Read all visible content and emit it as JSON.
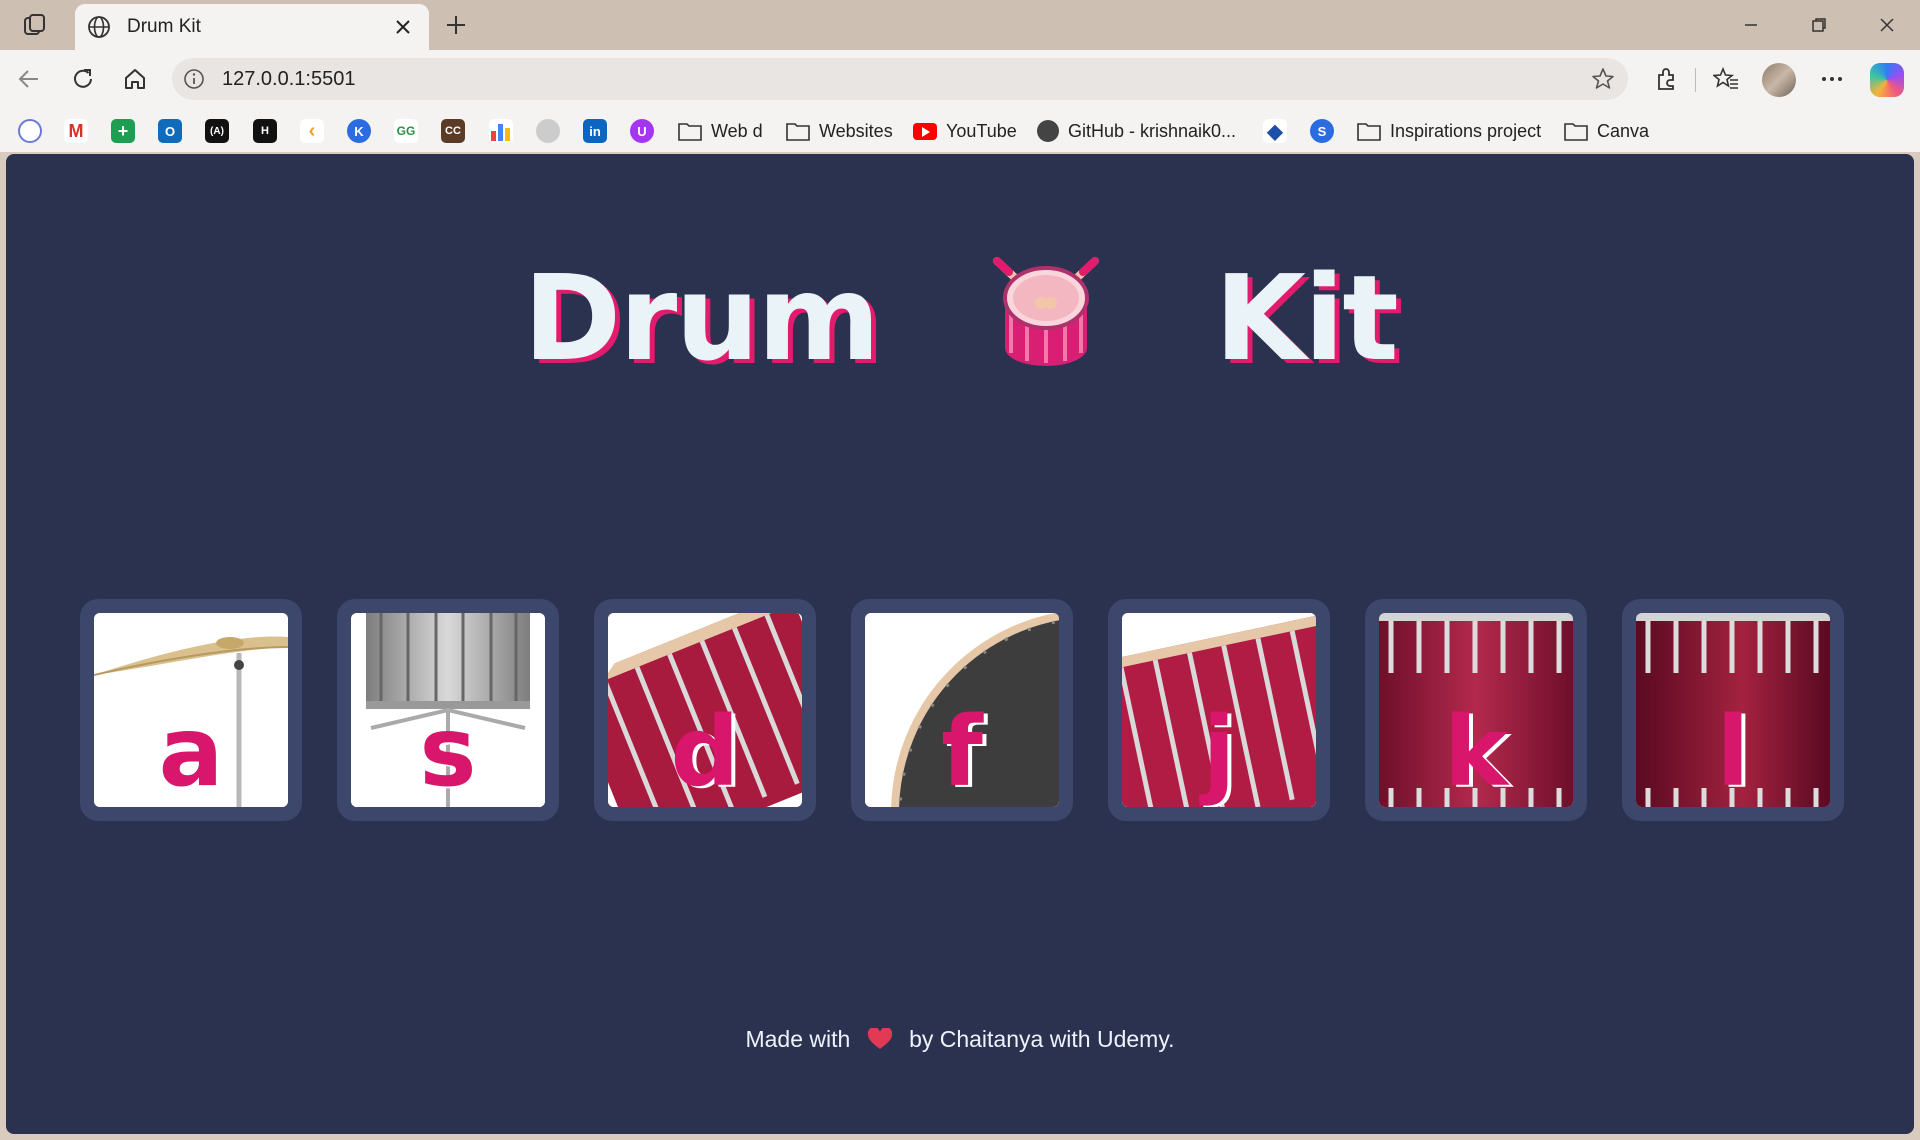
{
  "browser": {
    "tab_title": "Drum Kit",
    "url": "127.0.0.1:5501",
    "bookmarks": [
      {
        "type": "folder",
        "label": "Web d"
      },
      {
        "type": "folder",
        "label": "Websites"
      },
      {
        "type": "youtube",
        "label": "YouTube"
      },
      {
        "type": "github",
        "label": "GitHub - krishnaik0..."
      },
      {
        "type": "folder",
        "label": "Inspirations project"
      },
      {
        "type": "folder",
        "label": "Canva"
      }
    ],
    "bookmark_icons": [
      "chrome-icon",
      "gmail-icon",
      "sheets-icon",
      "outlook-icon",
      "devto-icon",
      "hackerrank-icon",
      "leetcode-icon",
      "krishna-icon",
      "gfg-icon",
      "codechef-icon",
      "chart-icon",
      "github-icon",
      "linkedin-icon",
      "udemy-icon"
    ]
  },
  "page": {
    "title_left": "Drum",
    "title_right": "Kit",
    "drums": [
      {
        "key": "a",
        "image": "crash-cymbal"
      },
      {
        "key": "s",
        "image": "snare-drum"
      },
      {
        "key": "d",
        "image": "tom-1"
      },
      {
        "key": "f",
        "image": "bass-drum"
      },
      {
        "key": "j",
        "image": "tom-2"
      },
      {
        "key": "k",
        "image": "tom-3"
      },
      {
        "key": "l",
        "image": "tom-4"
      }
    ],
    "footer": {
      "before": "Made with",
      "after": "by Chaitanya with Udemy."
    }
  },
  "colors": {
    "background": "#2b3250",
    "drum_frame": "#3d466b",
    "accent": "#e31b6d",
    "title_text": "#e9f3f8"
  }
}
